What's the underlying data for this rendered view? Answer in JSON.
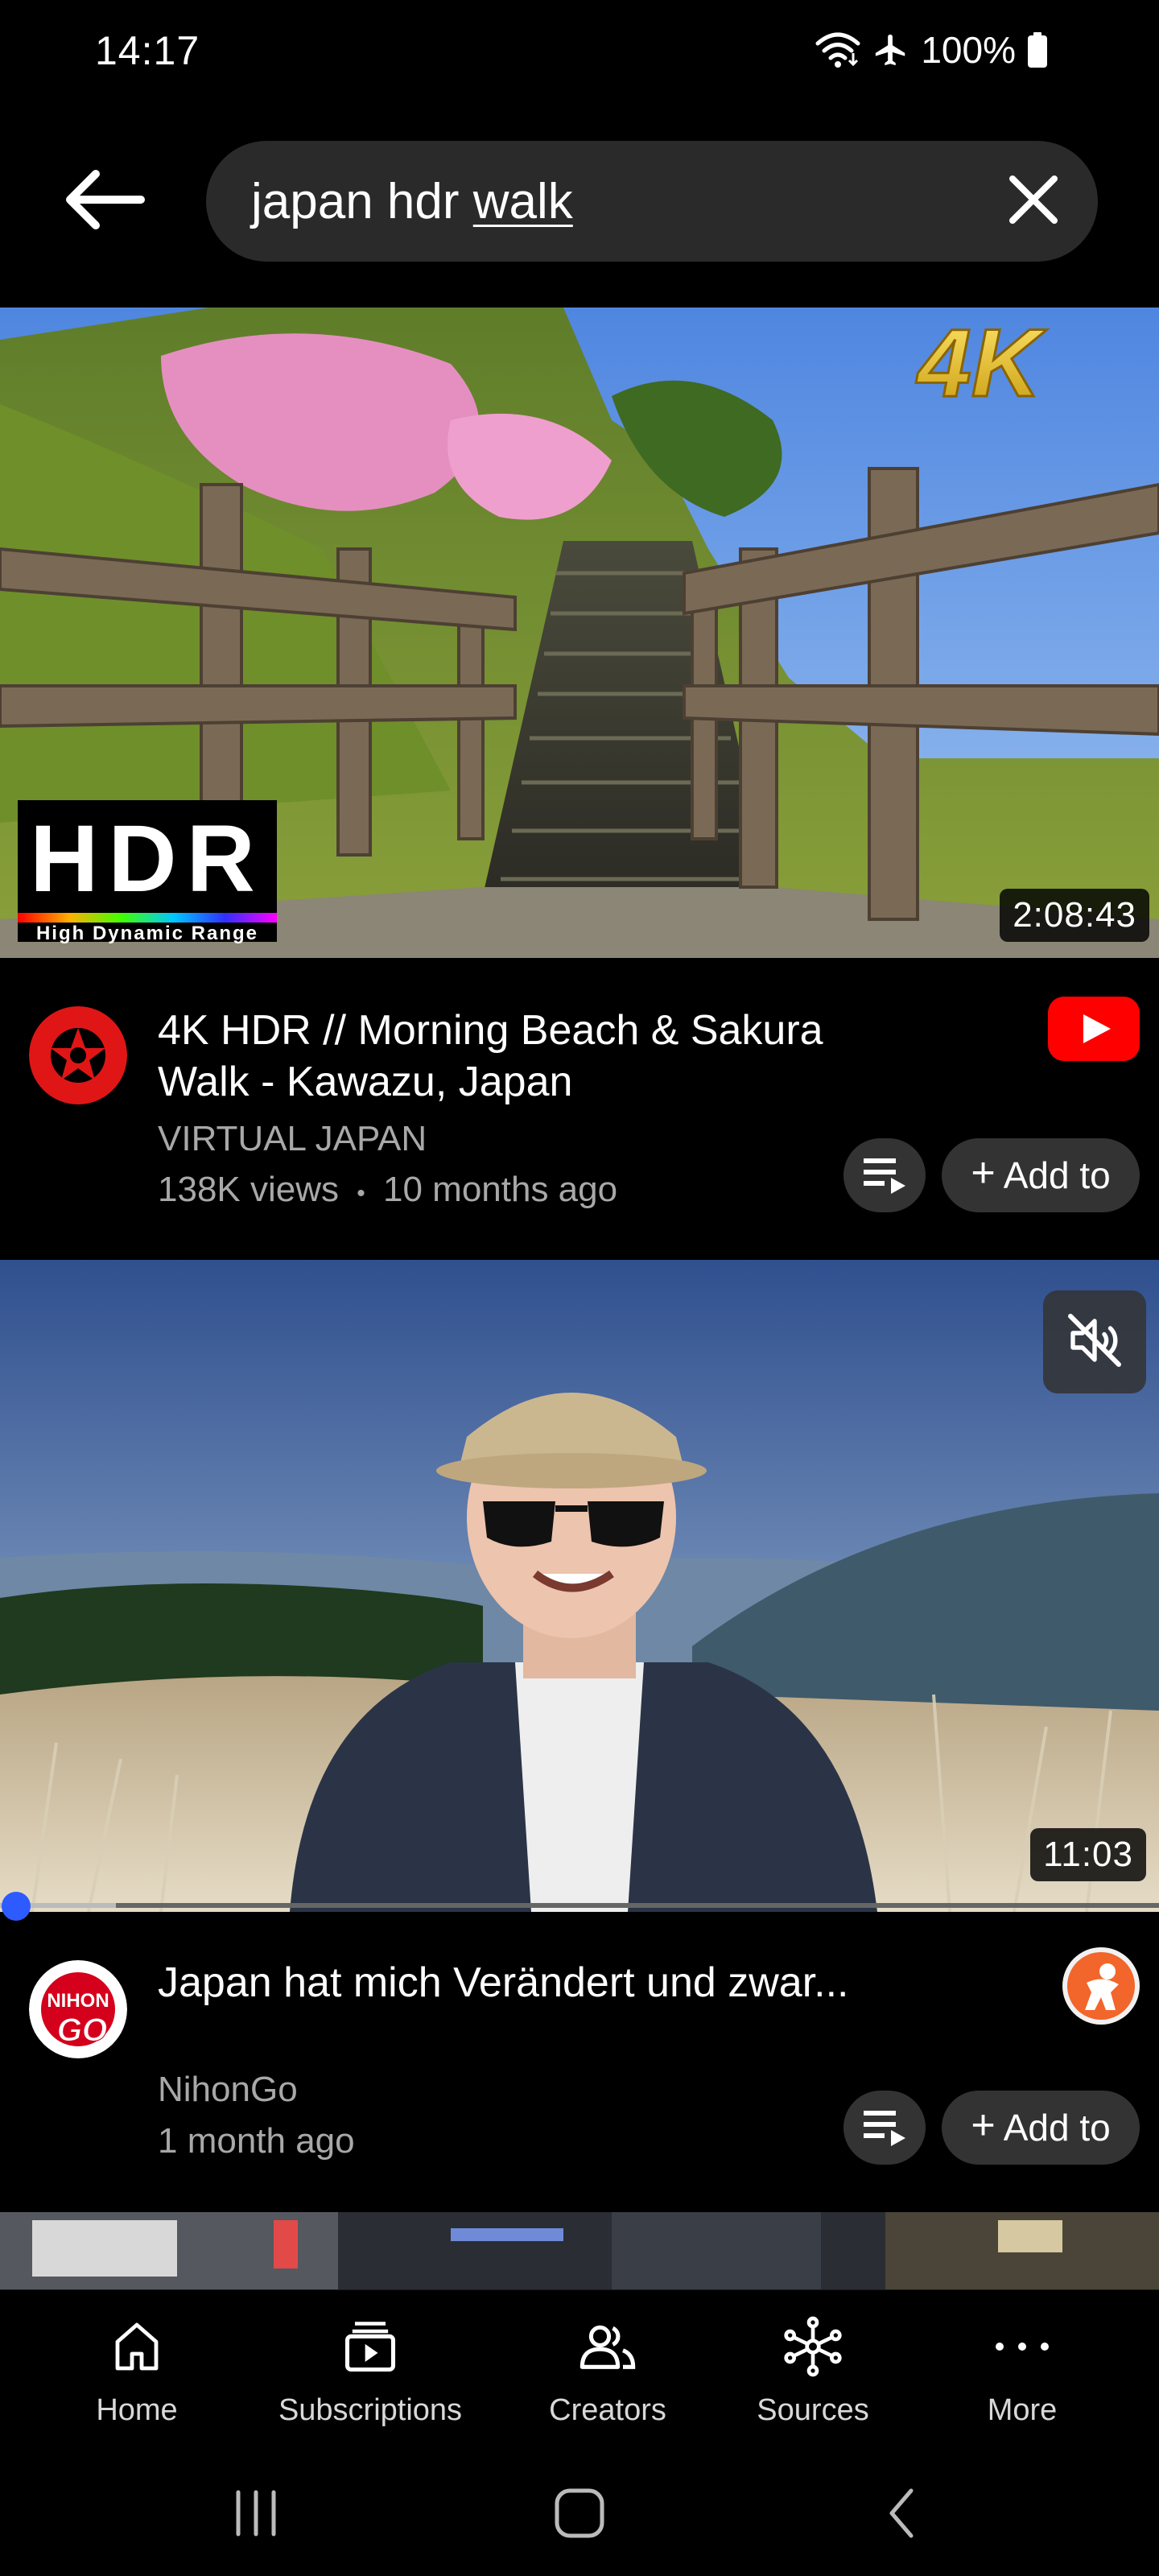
{
  "status_bar": {
    "time": "14:17",
    "battery": "100%",
    "icons": [
      "wifi-icon",
      "airplane-icon",
      "battery-icon"
    ]
  },
  "search": {
    "query_prefix": "japan hdr ",
    "query_underlined": "walk",
    "back_icon": "back-arrow-icon",
    "clear_icon": "close-icon"
  },
  "videos": [
    {
      "title": "4K HDR // Morning Beach & Sakura Walk - Kawazu, Japan",
      "channel": "VIRTUAL JAPAN",
      "views": "138K views",
      "separator": "•",
      "age": "10 months ago",
      "duration": "2:08:43",
      "thumb_badge_top": "4K",
      "thumb_badge_hdr": "HDR",
      "thumb_badge_hdr_sub": "High Dynamic Range",
      "source": "youtube-logo-icon",
      "add_label": "Add to"
    },
    {
      "title": "Japan hat mich Verändert und zwar...",
      "channel": "NihonGo",
      "age": "1 month ago",
      "duration": "11:03",
      "avatar_text_top": "NIHON",
      "avatar_text_bottom": "GO",
      "source": "peertube-logo-icon",
      "add_label": "Add to",
      "playback_progress": 0.1
    }
  ],
  "bottom_nav": [
    {
      "label": "Home",
      "icon": "home-icon"
    },
    {
      "label": "Subscriptions",
      "icon": "subscriptions-icon"
    },
    {
      "label": "Creators",
      "icon": "creators-icon"
    },
    {
      "label": "Sources",
      "icon": "sources-icon"
    },
    {
      "label": "More",
      "icon": "more-icon"
    }
  ],
  "colors": {
    "background": "#000000",
    "chip": "#333333",
    "secondary_text": "#a8a8a8",
    "youtube_red": "#ff0000",
    "progress_dot": "#2d5bff"
  }
}
